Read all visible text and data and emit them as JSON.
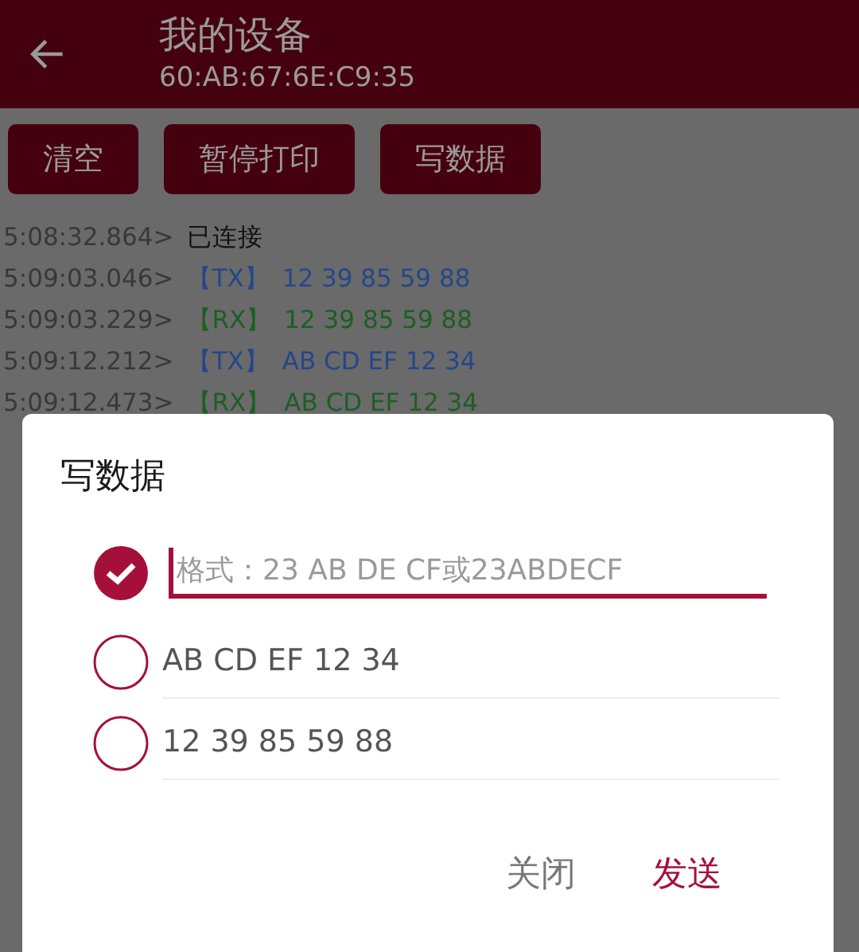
{
  "header": {
    "title": "我的设备",
    "subtitle": "60:AB:67:6E:C9:35"
  },
  "actions": [
    "清空",
    "暂停打印",
    "写数据"
  ],
  "log": [
    {
      "time": "5:08:32.864>",
      "kind": "status",
      "text": "已连接"
    },
    {
      "time": "5:09:03.046>",
      "kind": "tx",
      "tag": "【TX】",
      "text": "12 39 85 59 88"
    },
    {
      "time": "5:09:03.229>",
      "kind": "rx",
      "tag": "【RX】",
      "text": "12 39 85 59 88"
    },
    {
      "time": "5:09:12.212>",
      "kind": "tx",
      "tag": "【TX】",
      "text": "AB CD EF 12 34"
    },
    {
      "time": "5:09:12.473>",
      "kind": "rx",
      "tag": "【RX】",
      "text": "AB CD EF 12 34"
    }
  ],
  "dialog": {
    "title": "写数据",
    "options": [
      {
        "kind": "input",
        "placeholder": "格式：23 AB DE CF或23ABDECF",
        "selected": true
      },
      {
        "kind": "text",
        "text": "AB CD EF 12 34",
        "selected": false
      },
      {
        "kind": "text",
        "text": "12 39 85 59 88",
        "selected": false
      }
    ],
    "buttons": [
      {
        "label": "关闭",
        "kind": "secondary"
      },
      {
        "label": "发送",
        "kind": "primary"
      }
    ]
  }
}
